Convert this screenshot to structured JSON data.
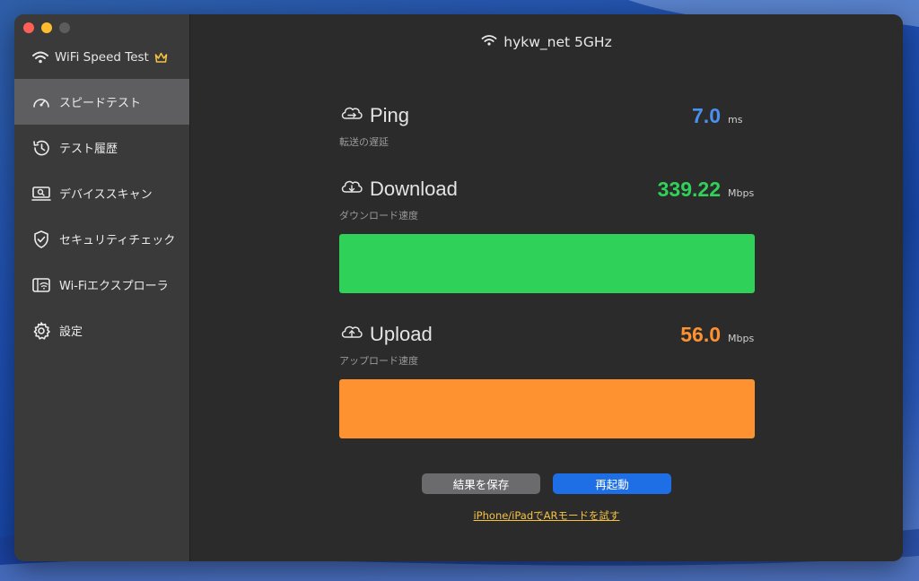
{
  "colors": {
    "ping": "#4a90f0",
    "download": "#30d158",
    "upload": "#ff9230",
    "crown": "#f5c242",
    "link": "#f5c242",
    "restart_button": "#1e6ee6"
  },
  "sidebar": {
    "app_title": "WiFi Speed Test",
    "items": [
      {
        "label": "スピードテスト",
        "icon": "speedometer-icon",
        "active": true
      },
      {
        "label": "テスト履歴",
        "icon": "history-icon",
        "active": false
      },
      {
        "label": "デバイススキャン",
        "icon": "device-scan-icon",
        "active": false
      },
      {
        "label": "セキュリティチェック",
        "icon": "shield-icon",
        "active": false
      },
      {
        "label": "Wi-Fiエクスプローラ",
        "icon": "router-icon",
        "active": false
      },
      {
        "label": "設定",
        "icon": "gear-icon",
        "active": false
      }
    ]
  },
  "main": {
    "network_name": "hykw_net 5GHz",
    "ping": {
      "label": "Ping",
      "sublabel": "転送の遅延",
      "value": "7.0",
      "unit": "ms"
    },
    "download": {
      "label": "Download",
      "sublabel": "ダウンロード速度",
      "value": "339.22",
      "unit": "Mbps",
      "fill_fraction": 1.0
    },
    "upload": {
      "label": "Upload",
      "sublabel": "アップロード速度",
      "value": "56.0",
      "unit": "Mbps",
      "fill_fraction": 1.0
    },
    "buttons": {
      "save": "結果を保存",
      "restart": "再起動"
    },
    "ar_link": "iPhone/iPadでARモードを試す"
  }
}
